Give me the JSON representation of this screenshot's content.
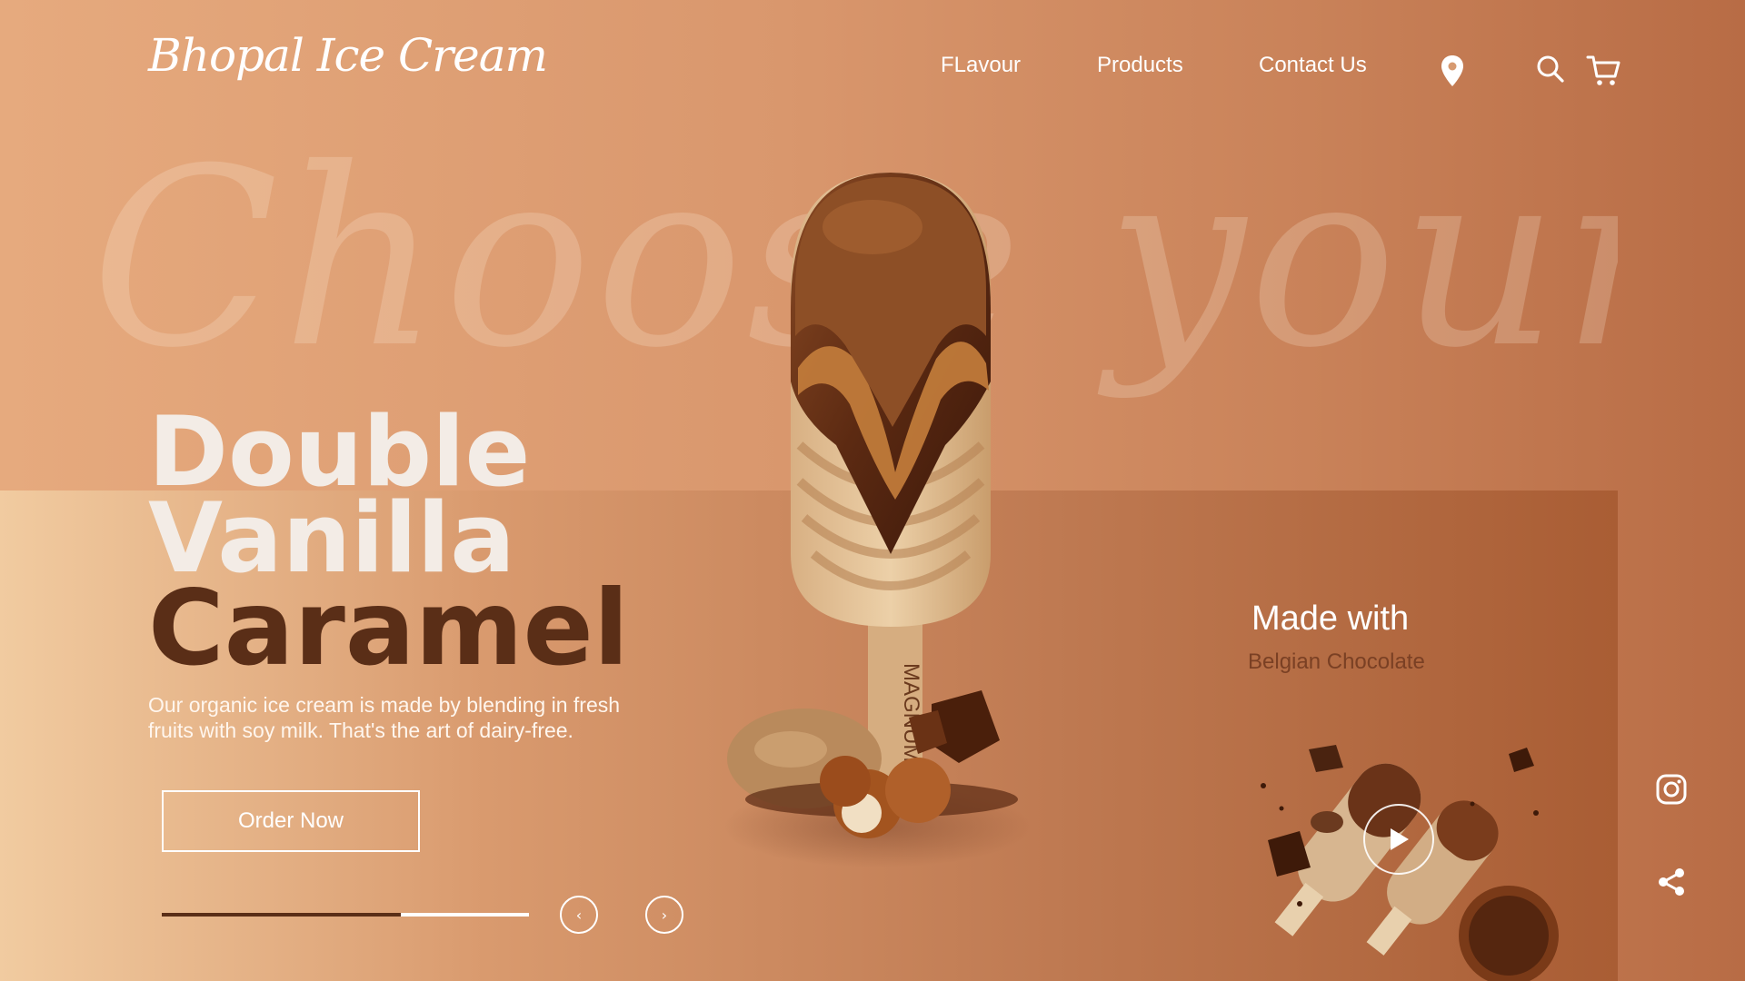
{
  "brand": {
    "name": "Bhopal Ice Cream"
  },
  "nav": {
    "items": [
      {
        "label": "FLavour"
      },
      {
        "label": "Products"
      },
      {
        "label": "Contact Us"
      }
    ],
    "icons": [
      "location-pin-icon",
      "search-icon",
      "cart-icon"
    ]
  },
  "background_text": "Choose your taste",
  "hero": {
    "line1": "Double",
    "line2": "Vanilla",
    "line3": "Caramel",
    "description": "Our organic ice cream is made by blending in fresh fruits with soy milk. That's the art of dairy-free.",
    "cta": "Order Now",
    "slider_progress": 0.65,
    "prev_symbol": "‹",
    "next_symbol": "›"
  },
  "product": {
    "stick_text": "MAGNUM®"
  },
  "feature": {
    "title": "Made with",
    "subtitle": "Belgian Chocolate"
  },
  "social": [
    "instagram-icon",
    "share-icon"
  ],
  "colors": {
    "accent_dark": "#5a2e17",
    "text_light": "#ffffff",
    "caramel": "#c07a3a"
  }
}
